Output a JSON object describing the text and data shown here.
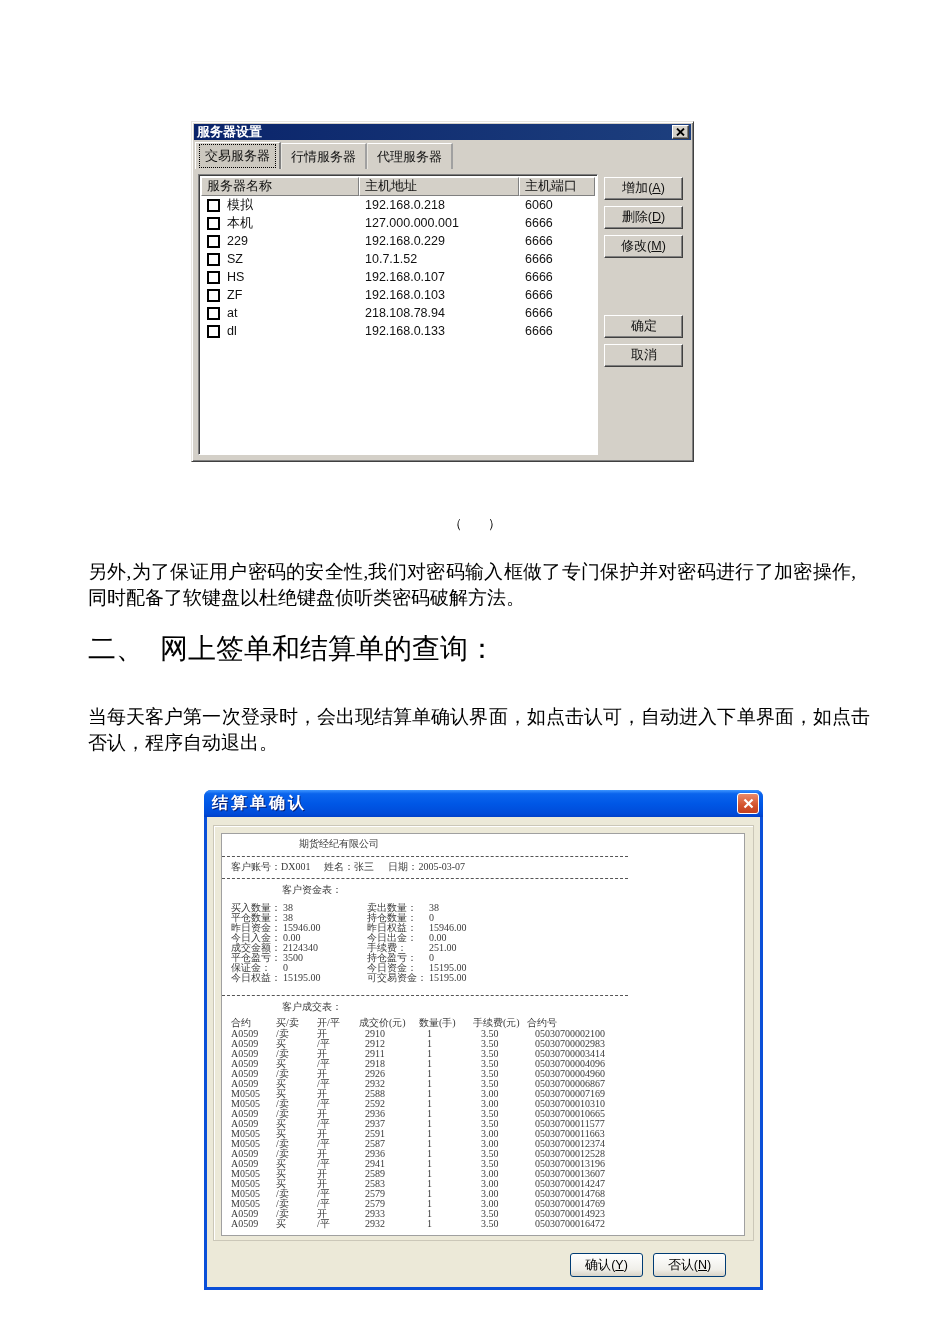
{
  "server_dialog": {
    "title": "服务器设置",
    "tabs": [
      {
        "label": "交易服务器",
        "selected": true
      },
      {
        "label": "行情服务器",
        "selected": false
      },
      {
        "label": "代理服务器",
        "selected": false
      }
    ],
    "columns": [
      "服务器名称",
      "主机地址",
      "主机端口"
    ],
    "rows": [
      {
        "checked": false,
        "name": "模拟",
        "address": "192.168.0.218",
        "port": "6060"
      },
      {
        "checked": false,
        "name": "本机",
        "address": "127.000.000.001",
        "port": "6666"
      },
      {
        "checked": false,
        "name": "229",
        "address": "192.168.0.229",
        "port": "6666"
      },
      {
        "checked": false,
        "name": "SZ",
        "address": "10.7.1.52",
        "port": "6666"
      },
      {
        "checked": false,
        "name": "HS",
        "address": "192.168.0.107",
        "port": "6666"
      },
      {
        "checked": false,
        "name": "ZF",
        "address": "192.168.0.103",
        "port": "6666"
      },
      {
        "checked": false,
        "name": "at",
        "address": "218.108.78.94",
        "port": "6666"
      },
      {
        "checked": false,
        "name": "dl",
        "address": "192.168.0.133",
        "port": "6666"
      }
    ],
    "edit_buttons": [
      {
        "text": "增加(",
        "hotkey": "A",
        "suffix": ")"
      },
      {
        "text": "删除(",
        "hotkey": "D",
        "suffix": ")"
      },
      {
        "text": "修改(",
        "hotkey": "M",
        "suffix": ")"
      }
    ],
    "confirm_buttons": [
      {
        "text": "确定"
      },
      {
        "text": "取消"
      }
    ]
  },
  "figure_caption": "（　　）",
  "paragraph_1": "另外,为了保证用户密码的安全性,我们对密码输入框做了专门保护并对密码进行了加密操作,同时配备了软键盘以杜绝键盘侦听类密码破解方法。",
  "section_heading": {
    "number": "二、",
    "title": "网上签单和结算单的查询："
  },
  "paragraph_2": "当每天客户第一次登录时，会出现结算单确认界面，如点击认可，自动进入下单界面，如点击否认，程序自动退出。",
  "settlement_dialog": {
    "title": "结算单确认",
    "statement": {
      "company": "期货经纪有限公司",
      "account": [
        "客户账号：DX001",
        "姓名：张三",
        "日期：2005-03-07"
      ],
      "funds_title": "客户资金表：",
      "funds": [
        {
          "label": "买入数量：",
          "value": "38"
        },
        {
          "label": "卖出数量：",
          "value": "38"
        },
        {
          "label": "平仓数量：",
          "value": "38"
        },
        {
          "label": "持仓数量：",
          "value": "0"
        },
        {
          "label": "昨日资金：",
          "value": "15946.00"
        },
        {
          "label": "昨日权益：",
          "value": "15946.00"
        },
        {
          "label": "今日入金：",
          "value": "0.00"
        },
        {
          "label": "今日出金：",
          "value": "0.00"
        },
        {
          "label": "成交金额：",
          "value": "2124340"
        },
        {
          "label": "手续费：",
          "value": "251.00"
        },
        {
          "label": "平仓盈亏：",
          "value": "3500"
        },
        {
          "label": "持仓盈亏：",
          "value": "0"
        },
        {
          "label": "保证金：",
          "value": "0"
        },
        {
          "label": "今日资金：",
          "value": "15195.00"
        },
        {
          "label": "今日权益：",
          "value": "15195.00"
        },
        {
          "label": "可交易资金：",
          "value": "15195.00"
        }
      ],
      "trades_title": "客户成交表：",
      "trade_columns": [
        "合约",
        "买/卖",
        "开/平",
        "成交价(元)",
        "数量(手)",
        "手续费(元)",
        "合约号"
      ],
      "trades": [
        [
          "A0509",
          "/卖",
          "开",
          "2910",
          "1",
          "3.50",
          "05030700002100"
        ],
        [
          "A0509",
          "买",
          "/平",
          "2912",
          "1",
          "3.50",
          "05030700002983"
        ],
        [
          "A0509",
          "/卖",
          "开",
          "2911",
          "1",
          "3.50",
          "05030700003414"
        ],
        [
          "A0509",
          "买",
          "/平",
          "2918",
          "1",
          "3.50",
          "05030700004096"
        ],
        [
          "A0509",
          "/卖",
          "开",
          "2926",
          "1",
          "3.50",
          "05030700004960"
        ],
        [
          "A0509",
          "买",
          "/平",
          "2932",
          "1",
          "3.50",
          "05030700006867"
        ],
        [
          "M0505",
          "买",
          "开",
          "2588",
          "1",
          "3.00",
          "05030700007169"
        ],
        [
          "M0505",
          "/卖",
          "/平",
          "2592",
          "1",
          "3.00",
          "05030700010310"
        ],
        [
          "A0509",
          "/卖",
          "开",
          "2936",
          "1",
          "3.50",
          "05030700010665"
        ],
        [
          "A0509",
          "买",
          "/平",
          "2937",
          "1",
          "3.50",
          "05030700011577"
        ],
        [
          "M0505",
          "买",
          "开",
          "2591",
          "1",
          "3.00",
          "05030700011663"
        ],
        [
          "M0505",
          "/卖",
          "/平",
          "2587",
          "1",
          "3.00",
          "05030700012374"
        ],
        [
          "A0509",
          "/卖",
          "开",
          "2936",
          "1",
          "3.50",
          "05030700012528"
        ],
        [
          "A0509",
          "买",
          "/平",
          "2941",
          "1",
          "3.50",
          "05030700013196"
        ],
        [
          "M0505",
          "买",
          "开",
          "2589",
          "1",
          "3.00",
          "05030700013607"
        ],
        [
          "M0505",
          "买",
          "开",
          "2583",
          "1",
          "3.00",
          "05030700014247"
        ],
        [
          "M0505",
          "/卖",
          "/平",
          "2579",
          "1",
          "3.00",
          "05030700014768"
        ],
        [
          "M0505",
          "/卖",
          "/平",
          "2579",
          "1",
          "3.00",
          "05030700014769"
        ],
        [
          "A0509",
          "/卖",
          "开",
          "2933",
          "1",
          "3.50",
          "05030700014923"
        ],
        [
          "A0509",
          "买",
          "/平",
          "2932",
          "1",
          "3.50",
          "05030700016472"
        ]
      ]
    },
    "buttons": [
      {
        "text": "确认(",
        "hotkey": "Y",
        "suffix": ")"
      },
      {
        "text": "否认(",
        "hotkey": "N",
        "suffix": ")"
      }
    ]
  }
}
